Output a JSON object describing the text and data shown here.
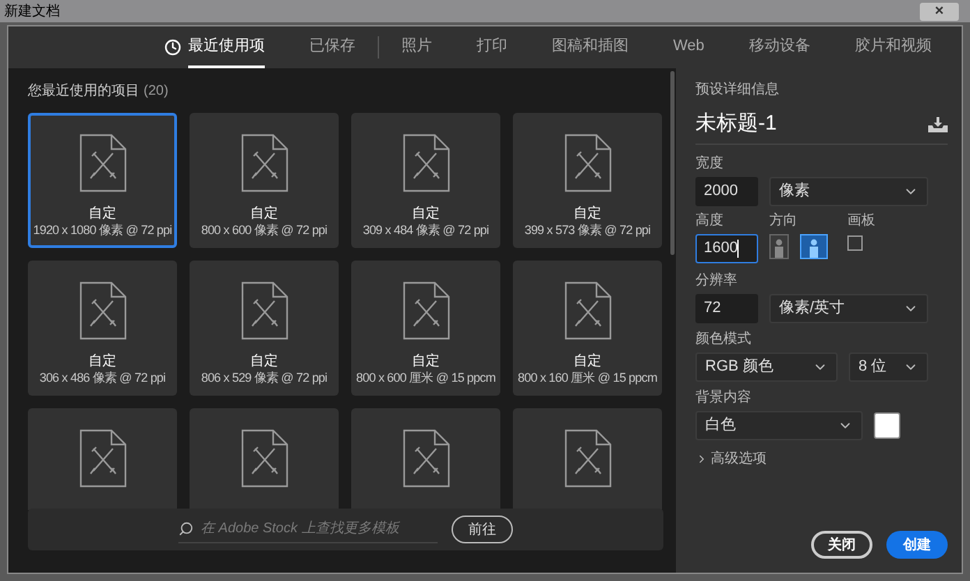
{
  "window": {
    "title": "新建文档",
    "close": "×"
  },
  "tabs": [
    {
      "label": "最近使用项",
      "selected": true,
      "icon": true
    },
    {
      "label": "已保存",
      "selected": false
    },
    {
      "label": "照片",
      "selected": false
    },
    {
      "label": "打印",
      "selected": false
    },
    {
      "label": "图稿和插图",
      "selected": false
    },
    {
      "label": "Web",
      "selected": false
    },
    {
      "label": "移动设备",
      "selected": false
    },
    {
      "label": "胶片和视频",
      "selected": false
    }
  ],
  "recent": {
    "heading": "您最近使用的项目",
    "count": "(20)",
    "items": [
      {
        "name": "自定",
        "size": "1920 x 1080 像素 @ 72 ppi",
        "selected": true
      },
      {
        "name": "自定",
        "size": "800 x 600 像素 @ 72 ppi",
        "selected": false
      },
      {
        "name": "自定",
        "size": "309 x 484 像素 @ 72 ppi",
        "selected": false
      },
      {
        "name": "自定",
        "size": "399 x 573 像素 @ 72 ppi",
        "selected": false
      },
      {
        "name": "自定",
        "size": "306 x 486 像素 @ 72 ppi",
        "selected": false
      },
      {
        "name": "自定",
        "size": "806 x 529 像素 @ 72 ppi",
        "selected": false
      },
      {
        "name": "自定",
        "size": "800 x 600 厘米 @ 15 ppcm",
        "selected": false
      },
      {
        "name": "自定",
        "size": "800 x 160 厘米 @ 15 ppcm",
        "selected": false
      },
      {
        "selected": false
      },
      {
        "selected": false
      },
      {
        "selected": false
      },
      {
        "selected": false
      }
    ]
  },
  "stock_search": {
    "placeholder": "在 Adobe Stock 上查找更多模板",
    "button": "前往"
  },
  "preset": {
    "heading": "预设详细信息",
    "title": "未标题-1",
    "width": {
      "label": "宽度",
      "value": "2000",
      "unit": "像素"
    },
    "height": {
      "label": "高度",
      "value": "1600",
      "focused": true
    },
    "orientation": {
      "label": "方向",
      "options": [
        {
          "kind": "portrait",
          "selected": false
        },
        {
          "kind": "landscape",
          "selected": true
        }
      ]
    },
    "artboard": {
      "label": "画板",
      "checked": false
    },
    "resolution": {
      "label": "分辨率",
      "value": "72",
      "unit": "像素/英寸"
    },
    "color_mode": {
      "label": "颜色模式",
      "mode": "RGB 颜色",
      "depth": "8 位"
    },
    "background": {
      "label": "背景内容",
      "value": "白色",
      "color": "#ffffff"
    },
    "advanced": {
      "label": "高级选项",
      "expanded": false
    }
  },
  "buttons": {
    "close": "关闭",
    "create": "创建"
  }
}
